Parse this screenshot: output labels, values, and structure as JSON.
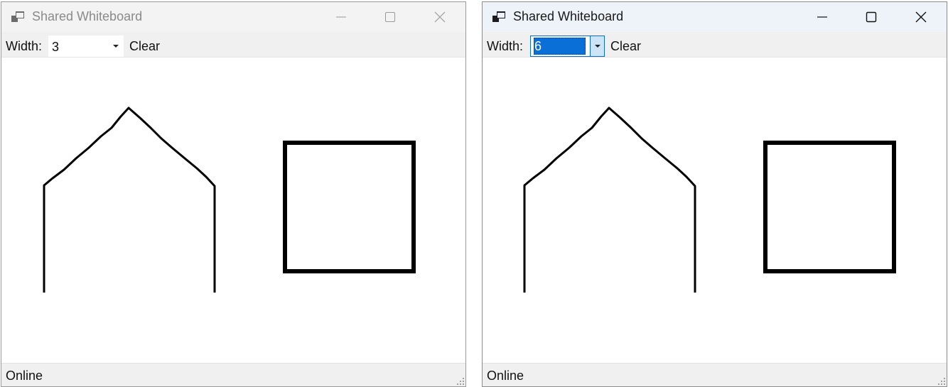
{
  "windows": [
    {
      "title": "Shared Whiteboard",
      "active": false,
      "toolbar": {
        "width_label": "Width:",
        "width_value": "3",
        "clear_label": "Clear"
      },
      "status": "Online",
      "stroke_width": 3
    },
    {
      "title": "Shared Whiteboard",
      "active": true,
      "toolbar": {
        "width_label": "Width:",
        "width_value": "6",
        "clear_label": "Clear"
      },
      "status": "Online",
      "stroke_width": 6
    }
  ],
  "icons": {
    "app": "app-window-icon",
    "minimize": "minimize-icon",
    "maximize": "maximize-icon",
    "close": "close-icon",
    "dropdown": "chevron-down-icon",
    "grip": "resize-grip-icon"
  },
  "colors": {
    "stroke": "#000000",
    "selection": "#0a6fd6",
    "active_titlebar": "#eef2f9"
  }
}
